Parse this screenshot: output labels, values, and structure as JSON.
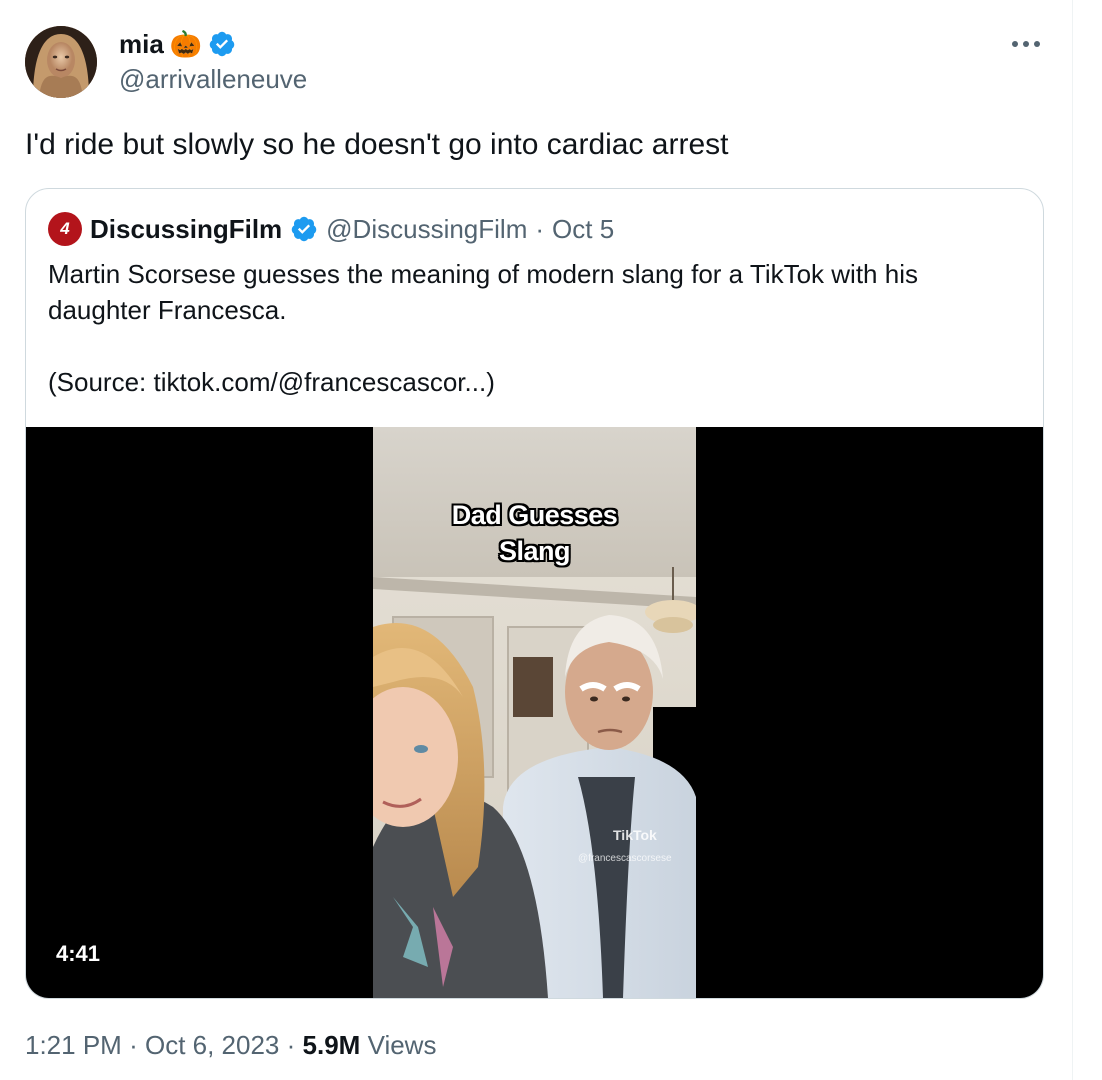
{
  "tweet": {
    "author": {
      "name": "mia",
      "handle": "@arrivalleneuve",
      "emoji": "🎃",
      "verified": true
    },
    "text": "I'd ride but slowly so he doesn't go into cardiac arrest",
    "time": "1:21 PM",
    "date": "Oct 6, 2023",
    "views_count": "5.9M",
    "views_label": "Views",
    "separator": "·"
  },
  "quote": {
    "logo_text": "4",
    "name": "DiscussingFilm",
    "handle": "@DiscussingFilm",
    "separator": "·",
    "date": "Oct 5",
    "verified": true,
    "body_line1": "Martin Scorsese guesses the meaning of modern slang for a TikTok with his daughter Francesca.",
    "body_line2": "(Source: tiktok.com/@francescascor...)",
    "video": {
      "duration": "4:41",
      "overlay_line1": "Dad Guesses",
      "overlay_line2": "Slang",
      "watermark": "TikTok",
      "watermark_handle": "@francescascorsese"
    }
  },
  "colors": {
    "verified_blue": "#1d9bf0",
    "text_primary": "#0f1419",
    "text_secondary": "#536471",
    "border": "#cfd9de",
    "logo_red": "#b3141b"
  },
  "icons": {
    "verified": "verified-badge-icon",
    "more": "more-options-icon",
    "pumpkin": "pumpkin-emoji"
  }
}
